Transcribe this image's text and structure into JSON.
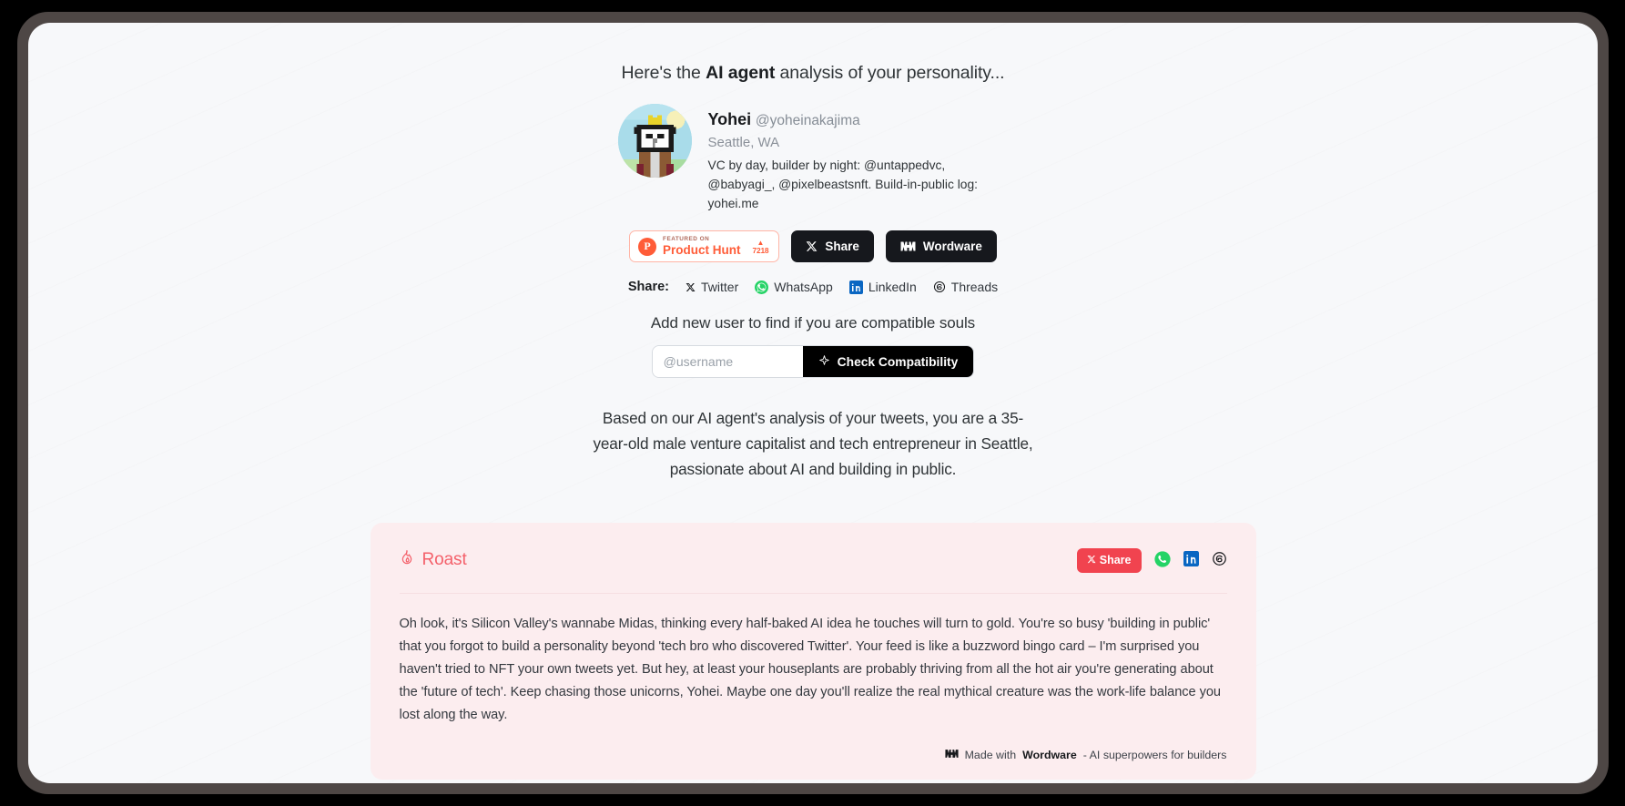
{
  "header": {
    "headline_before": "Here's the ",
    "headline_bold": "AI agent",
    "headline_after": " analysis of your personality..."
  },
  "profile": {
    "avatar_alt": "pixel-bear-crown-avatar",
    "display_name": "Yohei",
    "handle": "@yoheinakajima",
    "location": "Seattle, WA",
    "bio": "VC by day, builder by night: @untappedvc, @babyagi_, @pixelbeastsnft. Build-in-public log: yohei.me"
  },
  "badges": {
    "product_hunt": {
      "featured_label": "FEATURED ON",
      "name": "Product Hunt",
      "upvote_arrow": "▲",
      "upvotes": "7218"
    },
    "share_button": "Share",
    "wordware_button": "Wordware"
  },
  "share_bar": {
    "label": "Share:",
    "links": [
      {
        "name": "Twitter",
        "icon": "x-twitter-icon",
        "color": "#16181b"
      },
      {
        "name": "WhatsApp",
        "icon": "whatsapp-icon",
        "color": "#25d366"
      },
      {
        "name": "LinkedIn",
        "icon": "linkedin-icon",
        "color": "#0a66c2"
      },
      {
        "name": "Threads",
        "icon": "threads-icon",
        "color": "#16181b"
      }
    ]
  },
  "compatibility": {
    "title": "Add new user to find if you are compatible souls",
    "input_value": "",
    "input_placeholder": "@username",
    "button_label": "Check Compatibility",
    "button_icon": "sparkle-icon"
  },
  "analysis": {
    "text": "Based on our AI agent's analysis of your tweets, you are a 35-year-old male venture capitalist and tech entrepreneur in Seattle, passionate about AI and building in public."
  },
  "roast": {
    "title": "Roast",
    "title_icon": "flame-icon",
    "accent_color": "#f1434f",
    "card_bg": "#fcedef",
    "share_button": "Share",
    "body": "Oh look, it's Silicon Valley's wannabe Midas, thinking every half-baked AI idea he touches will turn to gold. You're so busy 'building in public' that you forgot to build a personality beyond 'tech bro who discovered Twitter'. Your feed is like a buzzword bingo card – I'm surprised you haven't tried to NFT your own tweets yet. But hey, at least your houseplants are probably thriving from all the hot air you're generating about the 'future of tech'. Keep chasing those unicorns, Yohei. Maybe one day you'll realize the real mythical creature was the work-life balance you lost along the way.",
    "footer_prefix": "Made with ",
    "footer_brand": "Wordware",
    "footer_suffix": " - AI superpowers for builders",
    "icons": [
      {
        "name": "whatsapp-icon",
        "color": "#25d366"
      },
      {
        "name": "linkedin-icon",
        "color": "#0a66c2"
      },
      {
        "name": "threads-icon",
        "color": "#16181b"
      }
    ]
  }
}
